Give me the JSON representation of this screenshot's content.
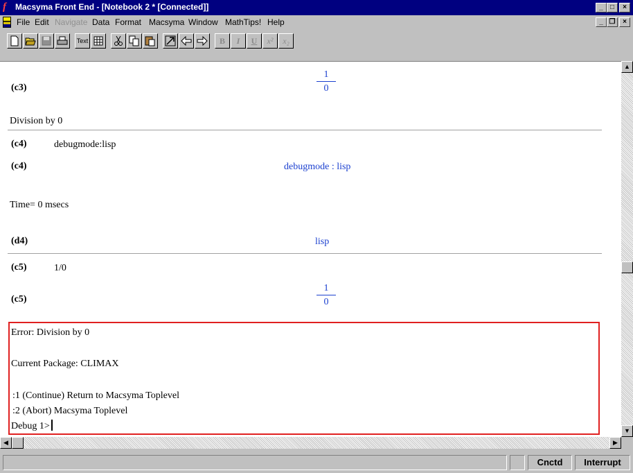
{
  "window": {
    "title": "Macsyma Front End - [Notebook 2 * [Connected]]",
    "app_icon": "f-sub-2-icon",
    "controls": [
      "minimize",
      "maximize",
      "close"
    ]
  },
  "menu": {
    "items": [
      {
        "label": "File",
        "enabled": true
      },
      {
        "label": "Edit",
        "enabled": true
      },
      {
        "label": "Navigate",
        "enabled": false
      },
      {
        "label": "Data",
        "enabled": true
      },
      {
        "label": "Format",
        "enabled": true
      },
      {
        "label": "Macsyma",
        "enabled": true
      },
      {
        "label": "Window",
        "enabled": true
      },
      {
        "label": "MathTips!",
        "enabled": true
      },
      {
        "label": "Help",
        "enabled": true
      }
    ]
  },
  "toolbar": {
    "text_label": "Text",
    "bold_label": "B",
    "italic_label": "I",
    "underline_label": "U",
    "superscript_label": "x²",
    "subscript_label": "x₂"
  },
  "notebook": {
    "c3": {
      "label": "(c3)",
      "numerator": "1",
      "denominator": "0"
    },
    "c3_message": "Division by 0",
    "c4_input": {
      "label": "(c4)",
      "text": "debugmode:lisp"
    },
    "c4_output": {
      "label": "(c4)",
      "text": "debugmode : lisp"
    },
    "time_text": "Time= 0 msecs",
    "d4": {
      "label": "(d4)",
      "text": "lisp"
    },
    "c5_input": {
      "label": "(c5)",
      "text": "1/0"
    },
    "c5_output": {
      "label": "(c5)",
      "numerator": "1",
      "denominator": "0"
    },
    "error": {
      "line1": "Error: Division by 0",
      "package": "Current Package: CLIMAX",
      "option1": ":1 (Continue) Return to Macsyma Toplevel",
      "option2": ":2 (Abort) Macsyma Toplevel",
      "prompt": "Debug 1>"
    }
  },
  "statusbar": {
    "connection": "Cnctd",
    "interrupt": "Interrupt"
  },
  "colors": {
    "title_bar": "#000080",
    "output_text": "#1a3fcf",
    "error_border": "#e02020"
  }
}
